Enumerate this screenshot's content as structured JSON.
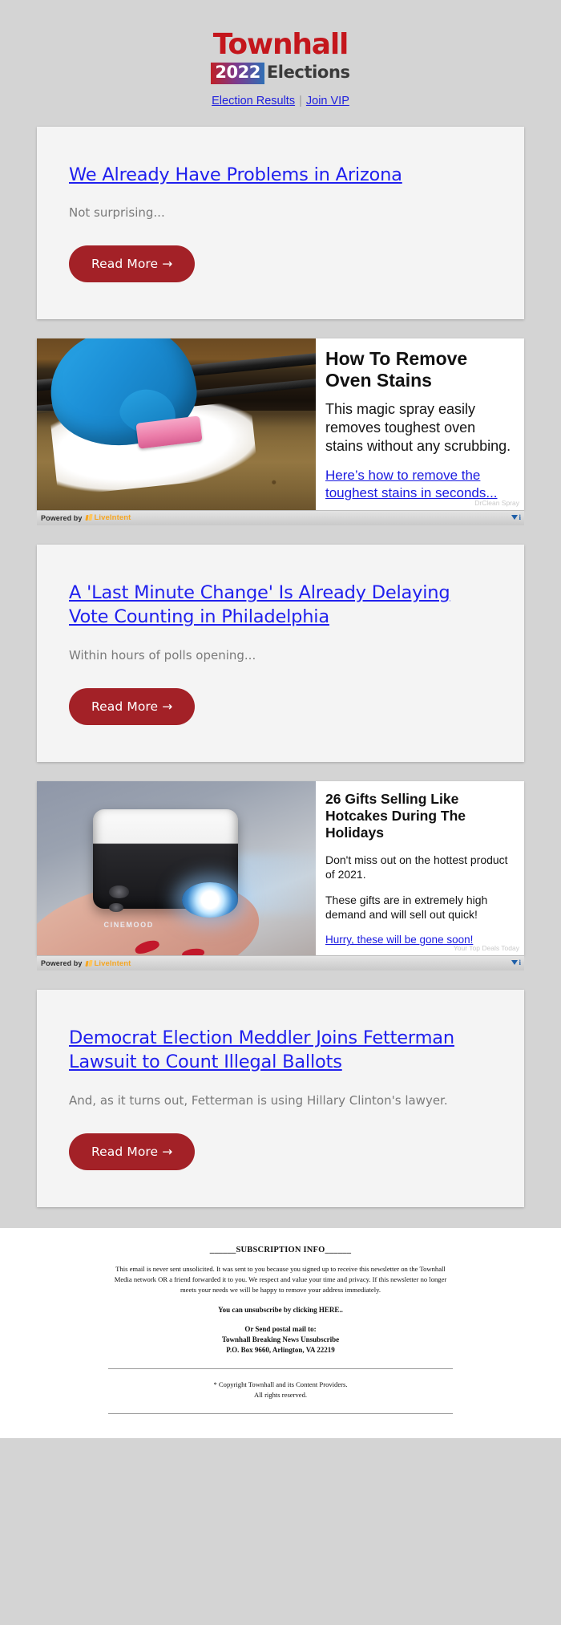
{
  "header": {
    "logo_main": "Townhall",
    "logo_year": "2022",
    "logo_word": "Elections",
    "nav": [
      {
        "label": "Election Results"
      },
      {
        "label": "Join VIP"
      }
    ],
    "nav_separator": "|"
  },
  "stories": [
    {
      "headline": "We Already Have Problems in Arizona",
      "dek": "Not surprising...",
      "cta": "Read More  →"
    },
    {
      "headline": "A 'Last Minute Change' Is Already Delaying Vote Counting in Philadelphia",
      "dek": "Within hours of polls opening...",
      "cta": "Read More  →"
    },
    {
      "headline": "Democrat Election Meddler Joins Fetterman Lawsuit to Count Illegal Ballots",
      "dek": "And, as it turns out, Fetterman is using Hillary Clinton's lawyer.",
      "cta": "Read More  →"
    }
  ],
  "ads": [
    {
      "title": "How To Remove Oven Stains",
      "body": "This magic spray easily removes toughest oven stains without any scrubbing.",
      "cta": "Here’s how to remove the toughest stains in seconds...",
      "sponsor": "DrClean Spray",
      "powered_by": "Powered by",
      "network": "LiveIntent",
      "adchoices": "i"
    },
    {
      "title": "26 Gifts Selling Like Hotcakes During The Holidays",
      "body1": "Don't miss out on the hottest product of 2021.",
      "body2": "These gifts are in extremely high demand and will sell out quick!",
      "cta": "Hurry, these will be gone soon!",
      "sponsor": "Your Top Deals Today",
      "powered_by": "Powered by",
      "network": "LiveIntent",
      "adchoices": "i"
    }
  ],
  "footer": {
    "subscription_heading": "______SUBSCRIPTION INFO______",
    "paragraph": "This email is never sent unsolicited. It was sent to you because you signed up to receive this newsletter on the Townhall Media network OR a friend forwarded it to you. We respect and value your time and privacy. If this newsletter no longer meets your needs we will be happy to remove your address immediately.",
    "unsubscribe": "You can unsubscribe by clicking HERE..",
    "postal_line1": "Or Send postal mail to:",
    "postal_line2": "Townhall Breaking News Unsubscribe",
    "postal_line3": "P.O. Box 9660, Arlington, VA 22219",
    "copyright_line1": "* Copyright Townhall and its Content Providers.",
    "copyright_line2": "All rights reserved."
  },
  "colors": {
    "brand_red": "#c4161c",
    "button_red": "#a32127",
    "link_blue": "#2020ee",
    "page_bg": "#d4d4d4",
    "card_bg": "#f4f4f4",
    "network_orange": "#f5a623"
  }
}
